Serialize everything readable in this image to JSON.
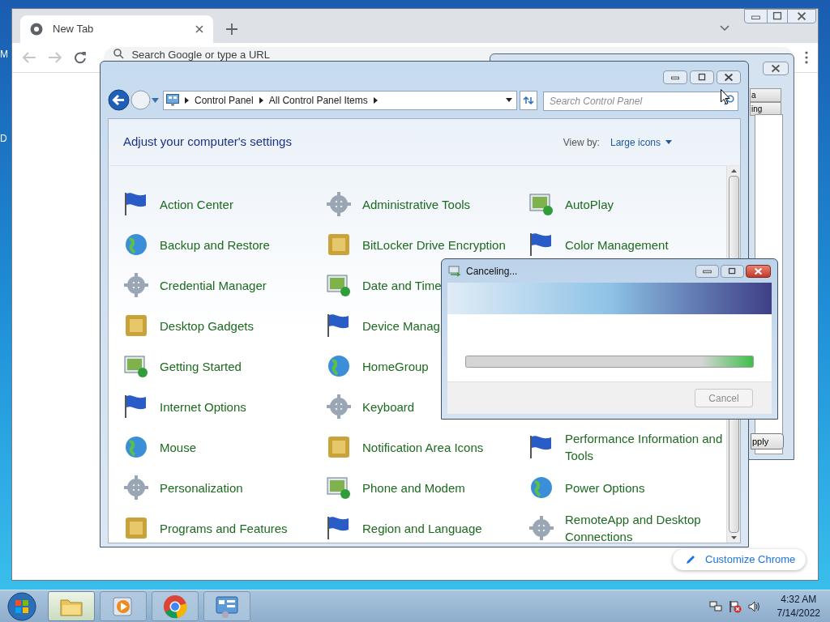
{
  "desktop": {
    "icon_labels": [
      "M",
      "D"
    ]
  },
  "chrome": {
    "tabs": [
      {
        "title": "New Tab",
        "selected": true
      }
    ],
    "omnibox": {
      "placeholder": "Search Google or type a URL"
    },
    "customize_button": "Customize Chrome"
  },
  "background_dialog": {
    "tab_fragments": [
      "a",
      "ing"
    ],
    "button": "pply"
  },
  "control_panel": {
    "breadcrumbs": [
      "Control Panel",
      "All Control Panel Items"
    ],
    "search": {
      "placeholder": "Search Control Panel"
    },
    "heading": "Adjust your computer's settings",
    "view_by_label": "View by:",
    "view_by_value": "Large icons",
    "rows": [
      {
        "items": [
          "Action Center",
          "Administrative Tools",
          "AutoPlay"
        ]
      },
      {
        "items": [
          "Backup and Restore",
          "BitLocker Drive Encryption",
          "Color Management"
        ]
      },
      {
        "items": [
          "Credential Manager",
          "Date and Time"
        ]
      },
      {
        "items": [
          "Desktop Gadgets",
          "Device Manag"
        ]
      },
      {
        "items": [
          "Getting Started",
          "HomeGroup"
        ]
      },
      {
        "items": [
          "Internet Options",
          "Keyboard"
        ]
      },
      {
        "items": [
          "Mouse",
          "Notification Area Icons",
          "Performance Information and Tools"
        ]
      },
      {
        "items": [
          "Personalization",
          "Phone and Modem",
          "Power Options"
        ]
      },
      {
        "items": [
          "Programs and Features",
          "Region and Language",
          "RemoteApp and Desktop Connections"
        ]
      }
    ]
  },
  "progress_dialog": {
    "title": "Canceling...",
    "button": {
      "label": "Cancel",
      "disabled": true
    }
  },
  "taskbar": {
    "items": [
      {
        "kind": "folder",
        "selected": true
      },
      {
        "kind": "media",
        "selected": false
      },
      {
        "kind": "chrome",
        "selected": false
      },
      {
        "kind": "control-panel",
        "selected": false
      }
    ],
    "clock": {
      "time": "4:32 AM",
      "date": "7/14/2022"
    }
  }
}
